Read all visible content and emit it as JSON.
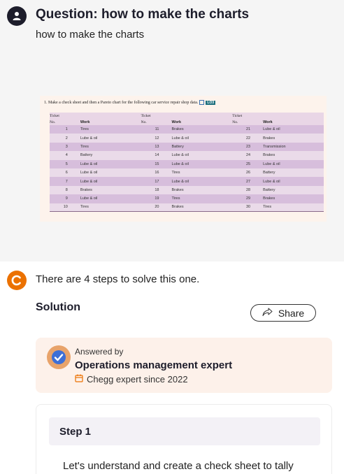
{
  "question": {
    "title": "Question: how to make the charts",
    "text": "how to make the charts",
    "image": {
      "caption": "1. Make a check sheet and then a Pareto chart for the following car service repair shop data.",
      "lo_badge": "LO3",
      "header_ticket": "Ticket",
      "header_no": "No.",
      "header_work": "Work",
      "rows": [
        [
          "1",
          "Tires",
          "11",
          "Brakes",
          "21",
          "Lube & oil"
        ],
        [
          "2",
          "Lube & oil",
          "12",
          "Lube & oil",
          "22",
          "Brakes"
        ],
        [
          "3",
          "Tires",
          "13",
          "Battery",
          "23",
          "Transmission"
        ],
        [
          "4",
          "Battery",
          "14",
          "Lube & oil",
          "24",
          "Brakes"
        ],
        [
          "5",
          "Lube & oil",
          "15",
          "Lube & oil",
          "25",
          "Lube & oil"
        ],
        [
          "6",
          "Lube & oil",
          "16",
          "Tires",
          "26",
          "Battery"
        ],
        [
          "7",
          "Lube & oil",
          "17",
          "Lube & oil",
          "27",
          "Lube & oil"
        ],
        [
          "8",
          "Brakes",
          "18",
          "Brakes",
          "28",
          "Battery"
        ],
        [
          "9",
          "Lube & oil",
          "19",
          "Tires",
          "29",
          "Brakes"
        ],
        [
          "10",
          "Tires",
          "20",
          "Brakes",
          "30",
          "Tires"
        ]
      ]
    }
  },
  "answer": {
    "steps_text": "There are 4 steps to solve this one.",
    "solution_heading": "Solution",
    "share_label": "Share",
    "answered_by": "Answered by",
    "expert_title": "Operations management expert",
    "expert_since": "Chegg expert since 2022",
    "step_title": "Step 1",
    "step_text": "Let's understand and  create a check sheet to tally"
  },
  "icons": {
    "user": "user-icon",
    "chegg": "chegg-logo-icon",
    "share": "share-arrow-icon",
    "expert": "expert-verified-avatar-icon",
    "calendar": "calendar-icon"
  },
  "colors": {
    "chegg_orange": "#eb7100",
    "card_bg": "#fdf1ea",
    "question_bg": "#f5f5f5",
    "table_band_dark": "#d7bedc",
    "table_band_light": "#eadbe9"
  }
}
